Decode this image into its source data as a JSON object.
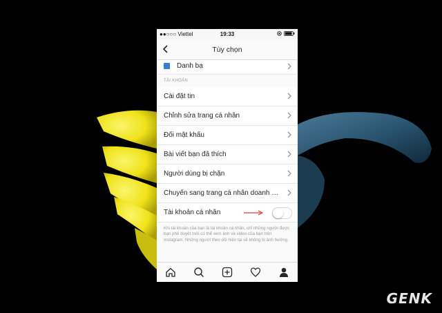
{
  "status_bar": {
    "carrier": "●●○○○ Viettel",
    "time": "19:33"
  },
  "nav": {
    "title": "Tùy chọn"
  },
  "contacts_item": {
    "label": "Danh bạ"
  },
  "account_section": {
    "title": "TÀI KHOẢN"
  },
  "account_items": [
    {
      "label": "Cài đặt tin"
    },
    {
      "label": "Chỉnh sửa trang cá nhân"
    },
    {
      "label": "Đổi mật khẩu"
    },
    {
      "label": "Bài viết bạn đã thích"
    },
    {
      "label": "Người dùng bị chặn"
    },
    {
      "label": "Chuyển sang trang cá nhân doanh n..."
    }
  ],
  "private_account": {
    "label": "Tài khoản cá nhân",
    "enabled": false,
    "description": "Khi tài khoản của bạn là tài khoản cá nhân, chỉ những người được bạn phê duyệt mới có thể xem ảnh và video của bạn trên Instagram. Những người theo dõi hiện tại sẽ không bị ảnh hưởng."
  },
  "watermark": "GENK",
  "colors": {
    "accent_blue": "#3b7bd8",
    "arrow_red": "#e53935",
    "flower_yellow": "#f2e81a",
    "leaf_blue": "#2f5d7a"
  }
}
